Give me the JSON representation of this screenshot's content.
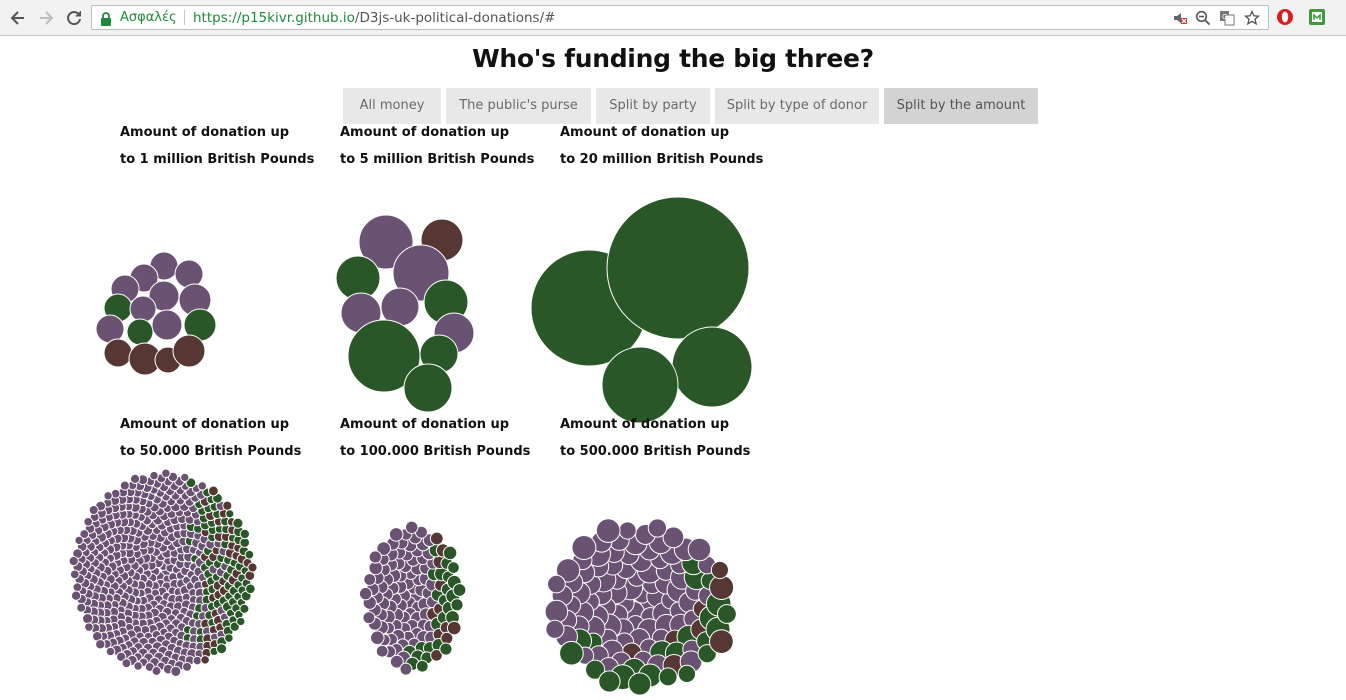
{
  "browser": {
    "secure_label": "Ασφαλές",
    "url_scheme": "https://",
    "url_host": "p15kivr.github.io",
    "url_path": "/D3js-uk-political-donations/#"
  },
  "page": {
    "title": "Who's funding the big three?"
  },
  "tabs": [
    {
      "label": "All money",
      "active": false
    },
    {
      "label": "The public's purse",
      "active": false
    },
    {
      "label": "Split by party",
      "active": false
    },
    {
      "label": "Split by type of donor",
      "active": false
    },
    {
      "label": "Split by the amount",
      "active": true
    }
  ],
  "groups": [
    {
      "line1": "Amount of donation up",
      "line2": "to 1 million British Pounds"
    },
    {
      "line1": "Amount of donation up",
      "line2": "to 5 million British Pounds"
    },
    {
      "line1": "Amount of donation up",
      "line2": "to 20 million British Pounds"
    },
    {
      "line1": "Amount of donation up",
      "line2": "to 50.000 British Pounds"
    },
    {
      "line1": "Amount of donation up",
      "line2": "to 100.000 British Pounds"
    },
    {
      "line1": "Amount of donation up",
      "line2": "to 500.000 British Pounds"
    }
  ],
  "colors": {
    "purple": "#6a5273",
    "green": "#2a5728",
    "brown": "#563733"
  },
  "icons": [
    "back-arrow-icon",
    "forward-arrow-icon",
    "reload-icon",
    "lock-icon",
    "muted-site-icon",
    "zoom-out-icon",
    "translate-icon",
    "bookmark-star-icon",
    "opera-icon",
    "extension-icon"
  ]
}
